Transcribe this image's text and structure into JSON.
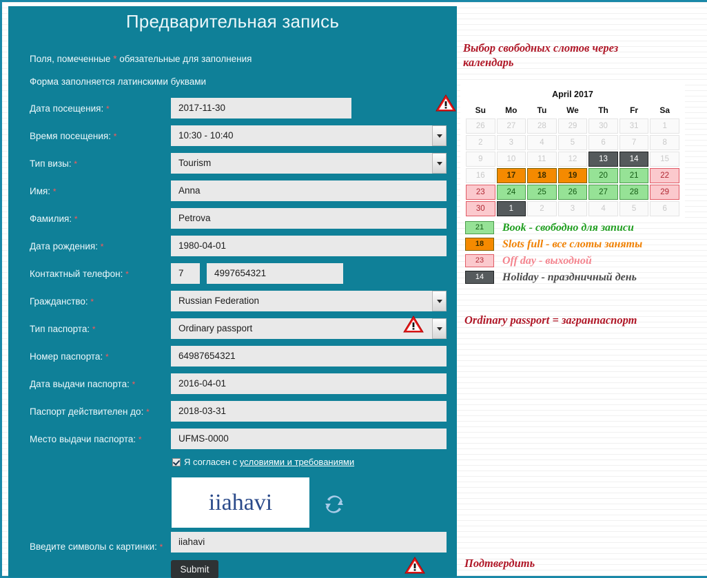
{
  "form": {
    "title": "Предварительная запись",
    "notes": [
      {
        "before": "Поля, помеченные ",
        "star": "*",
        "after": " обязательные для заполнения"
      },
      {
        "text": "Форма заполняется латинскими буквами"
      }
    ],
    "note1_before": "Поля, помеченные ",
    "note1_after": " обязательные для заполнения",
    "note2": "Форма заполняется латинскими буквами",
    "required_mark": "*",
    "fields": [
      {
        "label": "Дата посещения:",
        "value": "2017-11-30",
        "type": "text",
        "name": "visit-date"
      },
      {
        "label": "Время посещения:",
        "value": "10:30 - 10:40",
        "type": "select",
        "name": "visit-time"
      },
      {
        "label": "Тип визы:",
        "value": "Tourism",
        "type": "select",
        "name": "visa-type"
      },
      {
        "label": "Имя:",
        "value": "Anna",
        "type": "text",
        "name": "first-name"
      },
      {
        "label": "Фамилия:",
        "value": "Petrova",
        "type": "text",
        "name": "last-name"
      },
      {
        "label": "Дата рождения:",
        "value": "1980-04-01",
        "type": "text",
        "name": "birth-date"
      },
      {
        "label": "Контактный телефон:",
        "value": "4997654321",
        "code": "7",
        "type": "phone",
        "name": "phone"
      },
      {
        "label": "Гражданство:",
        "value": "Russian Federation",
        "type": "select",
        "name": "nationality"
      },
      {
        "label": "Тип паспорта:",
        "value": "Ordinary passport",
        "type": "select",
        "name": "passport-type"
      },
      {
        "label": "Номер паспорта:",
        "value": "64987654321",
        "type": "text",
        "name": "passport-number"
      },
      {
        "label": "Дата выдачи паспорта:",
        "value": "2016-04-01",
        "type": "text",
        "name": "passport-issue-date"
      },
      {
        "label": "Паспорт действителен до:",
        "value": "2018-03-31",
        "type": "text",
        "name": "passport-expiry-date"
      },
      {
        "label": "Место выдачи паспорта:",
        "value": "UFMS-0000",
        "type": "text",
        "name": "passport-issue-place"
      }
    ],
    "agree_prefix": "Я согласен с ",
    "agree_link": "условиями и требованиями",
    "captcha_image_text": "iiahavi",
    "captcha_label": "Введите символы с картинки:",
    "captcha_value": "iiahavi",
    "submit_label": "Submit"
  },
  "calendar_panel": {
    "heading": "Выбор свободных слотов через календарь",
    "month": "April 2017",
    "weekdays": [
      "Su",
      "Mo",
      "Tu",
      "We",
      "Th",
      "Fr",
      "Sa"
    ],
    "weeks": [
      [
        {
          "d": "26",
          "s": "out"
        },
        {
          "d": "27",
          "s": "out"
        },
        {
          "d": "28",
          "s": "out"
        },
        {
          "d": "29",
          "s": "out"
        },
        {
          "d": "30",
          "s": "out"
        },
        {
          "d": "31",
          "s": "out"
        },
        {
          "d": "1",
          "s": "out"
        }
      ],
      [
        {
          "d": "2",
          "s": "out"
        },
        {
          "d": "3",
          "s": "out"
        },
        {
          "d": "4",
          "s": "out"
        },
        {
          "d": "5",
          "s": "out"
        },
        {
          "d": "6",
          "s": "out"
        },
        {
          "d": "7",
          "s": "out"
        },
        {
          "d": "8",
          "s": "out"
        }
      ],
      [
        {
          "d": "9",
          "s": "out"
        },
        {
          "d": "10",
          "s": "out"
        },
        {
          "d": "11",
          "s": "out"
        },
        {
          "d": "12",
          "s": "out"
        },
        {
          "d": "13",
          "s": "holiday"
        },
        {
          "d": "14",
          "s": "holiday"
        },
        {
          "d": "15",
          "s": "out"
        }
      ],
      [
        {
          "d": "16",
          "s": "out"
        },
        {
          "d": "17",
          "s": "full"
        },
        {
          "d": "18",
          "s": "full"
        },
        {
          "d": "19",
          "s": "full"
        },
        {
          "d": "20",
          "s": "book"
        },
        {
          "d": "21",
          "s": "book"
        },
        {
          "d": "22",
          "s": "off"
        }
      ],
      [
        {
          "d": "23",
          "s": "off"
        },
        {
          "d": "24",
          "s": "book"
        },
        {
          "d": "25",
          "s": "book"
        },
        {
          "d": "26",
          "s": "book"
        },
        {
          "d": "27",
          "s": "book"
        },
        {
          "d": "28",
          "s": "book"
        },
        {
          "d": "29",
          "s": "off"
        }
      ],
      [
        {
          "d": "30",
          "s": "off"
        },
        {
          "d": "1",
          "s": "holiday"
        },
        {
          "d": "2",
          "s": "out"
        },
        {
          "d": "3",
          "s": "out"
        },
        {
          "d": "4",
          "s": "out"
        },
        {
          "d": "5",
          "s": "out"
        },
        {
          "d": "6",
          "s": "out"
        }
      ]
    ],
    "legend": [
      {
        "sample": "21",
        "state": "book",
        "text": "Book - свободно для записи"
      },
      {
        "sample": "18",
        "state": "full",
        "text": "Slots full - все слоты заняты"
      },
      {
        "sample": "23",
        "state": "off",
        "text": "Off day - выходной"
      },
      {
        "sample": "14",
        "state": "holiday",
        "text": "Holiday - праздничный день"
      }
    ],
    "passport_note": "Ordinary passport = загранпаспорт",
    "confirm_note": "Подтвердить"
  },
  "colors": {
    "panel_teal": "#0f8098",
    "field_gray": "#e9e9e9",
    "accent_red": "#b01828",
    "book_green": "#96e296",
    "full_orange": "#f58a00",
    "off_pink": "#fbc9cd",
    "holiday_gray": "#555a5c"
  }
}
